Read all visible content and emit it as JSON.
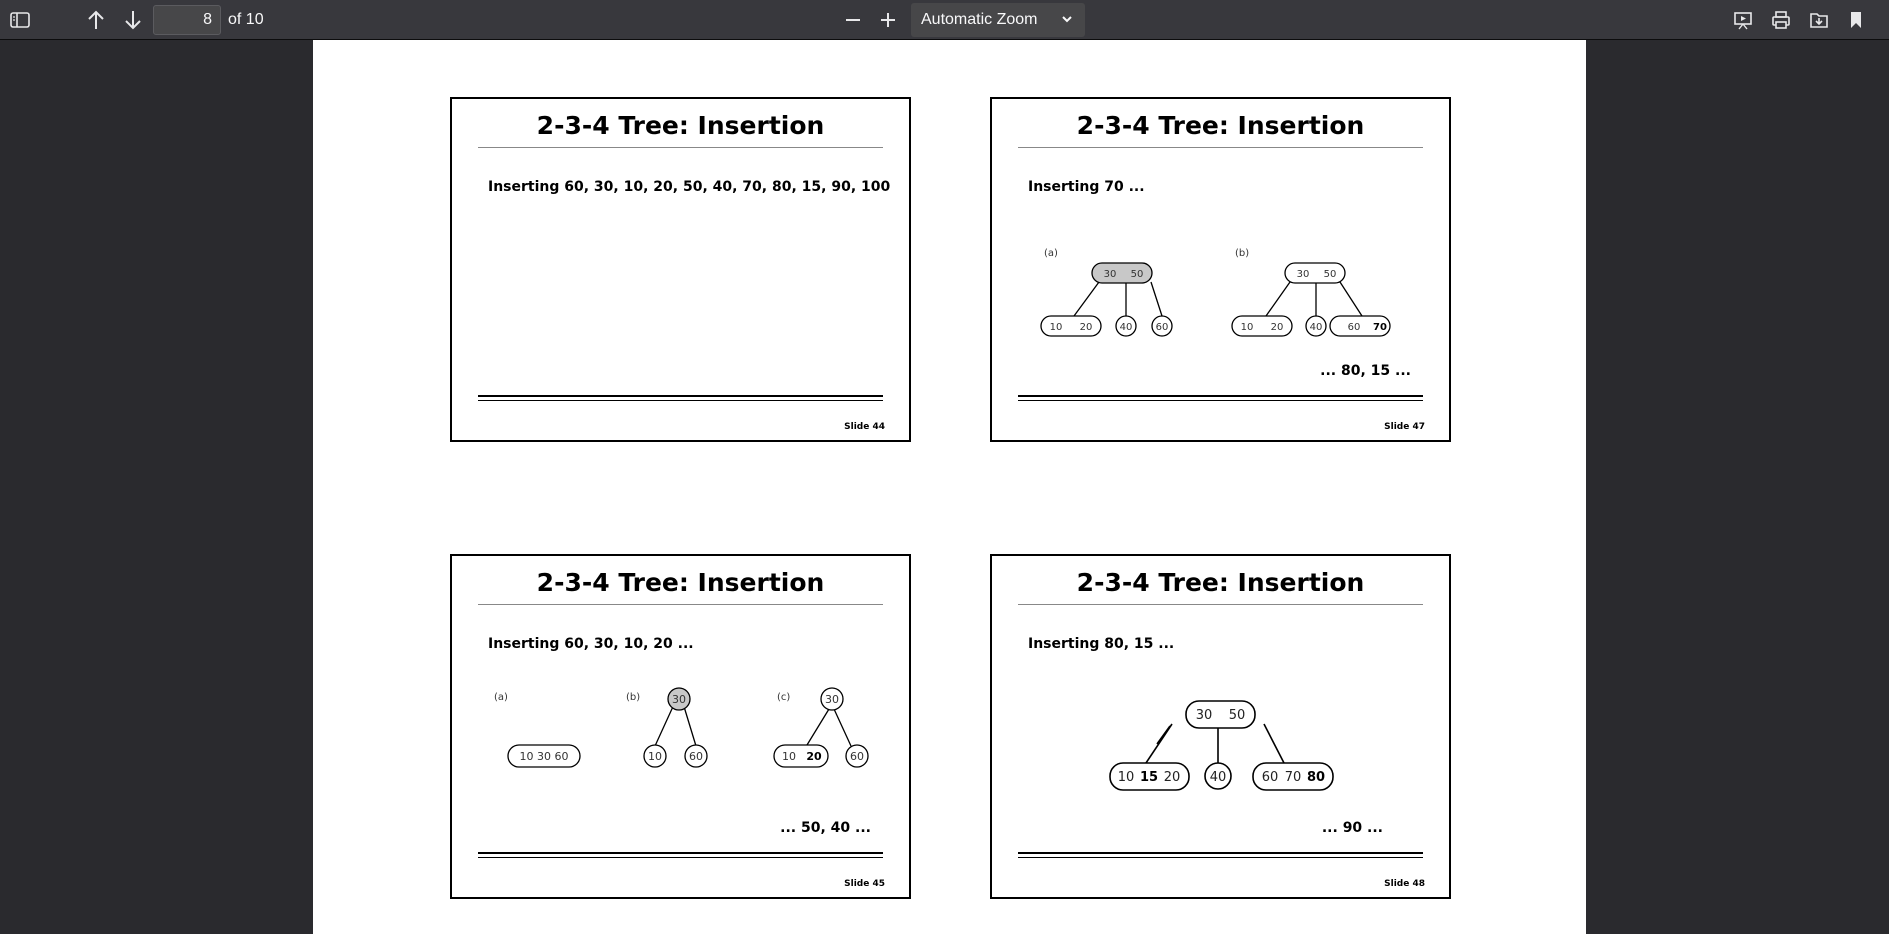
{
  "toolbar": {
    "sidebar_toggle_icon": "sidebar-toggle-icon",
    "prev_icon": "arrow-up-icon",
    "next_icon": "arrow-down-icon",
    "page_number": "8",
    "page_of": "of 10",
    "zoom_out_icon": "minus-icon",
    "zoom_in_icon": "plus-icon",
    "zoom_value": "Automatic Zoom",
    "right_icons": [
      "presentation-icon",
      "print-icon",
      "save-icon",
      "bookmark-icon"
    ]
  },
  "slides": [
    {
      "title": "2-3-4 Tree: Insertion",
      "subtitle": "Inserting 60, 30, 10, 20, 50, 40, 70, 80, 15, 90, 100",
      "number": "Slide 44",
      "continuation": ""
    },
    {
      "title": "2-3-4 Tree: Insertion",
      "subtitle": "Inserting 70 ...",
      "number": "Slide 47",
      "continuation": "... 80, 15 ...",
      "diagram": {
        "a_label": "(a)",
        "a_root": [
          "30",
          "50"
        ],
        "a_children": [
          [
            "10",
            "20"
          ],
          [
            "40"
          ],
          [
            "60"
          ]
        ],
        "b_label": "(b)",
        "b_root": [
          "30",
          "50"
        ],
        "b_children": [
          [
            "10",
            "20"
          ],
          [
            "40"
          ],
          [
            "60",
            "70"
          ]
        ]
      }
    },
    {
      "title": "2-3-4 Tree: Insertion",
      "subtitle": "Inserting 60, 30, 10, 20 ...",
      "number": "Slide 45",
      "continuation": "... 50, 40 ...",
      "diagram": {
        "a_label": "(a)",
        "a_node": "10 30 60",
        "b_label": "(b)",
        "b_root": "30",
        "b_children": [
          "10",
          "60"
        ],
        "c_label": "(c)",
        "c_root": "30",
        "c_children": [
          [
            "10",
            "20"
          ],
          [
            "60"
          ]
        ]
      }
    },
    {
      "title": "2-3-4 Tree: Insertion",
      "subtitle": "Inserting 80, 15 ...",
      "number": "Slide 48",
      "continuation": "... 90 ...",
      "diagram": {
        "root": [
          "30",
          "50"
        ],
        "children": [
          [
            "10",
            "15",
            "20"
          ],
          [
            "40"
          ],
          [
            "60",
            "70",
            "80"
          ]
        ]
      }
    }
  ]
}
